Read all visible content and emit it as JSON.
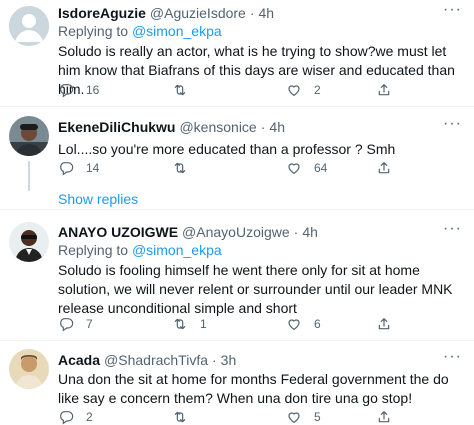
{
  "tweets": [
    {
      "name": "IsdoreAguzie",
      "handle": "@AguzieIsdore",
      "dot": "·",
      "time": "4h",
      "reply_prefix": "Replying to ",
      "reply_to": "@simon_ekpa",
      "text": "Soludo is really an actor, what is he trying to show?we must let him know that Biafrans of this days are wiser and educated than him.",
      "replies": "16",
      "retweets": "",
      "likes": "2"
    },
    {
      "name": "EkeneDiliChukwu",
      "handle": "@kensonice",
      "dot": "·",
      "time": "4h",
      "text": "Lol....so you're more educated than a professor ? Smh",
      "replies": "14",
      "retweets": "",
      "likes": "64"
    },
    {
      "name": "ANAYO UZOIGWE",
      "handle": "@AnayoUzoigwe",
      "dot": "·",
      "time": "4h",
      "reply_prefix": "Replying to ",
      "reply_to": "@simon_ekpa",
      "text": "Soludo is fooling himself he went there only for sit at home solution, we will never relent or surrounder until our leader MNK release unconditional simple and short",
      "replies": "7",
      "retweets": "1",
      "likes": "6"
    },
    {
      "name": "Acada",
      "handle": "@ShadrachTivfa",
      "dot": "·",
      "time": "3h",
      "text": "Una don the sit at home for months Federal government the do like say e concern them? When una don tire una go stop!",
      "replies": "2",
      "retweets": "",
      "likes": "5"
    }
  ],
  "show_replies": "Show replies",
  "icons": {
    "more": "more-icon",
    "reply": "reply-icon",
    "retweet": "retweet-icon",
    "like": "like-icon",
    "share": "share-icon"
  },
  "colors": {
    "accent": "#1d9bf0",
    "secondary_text": "#536471",
    "divider": "#eff3f4"
  }
}
